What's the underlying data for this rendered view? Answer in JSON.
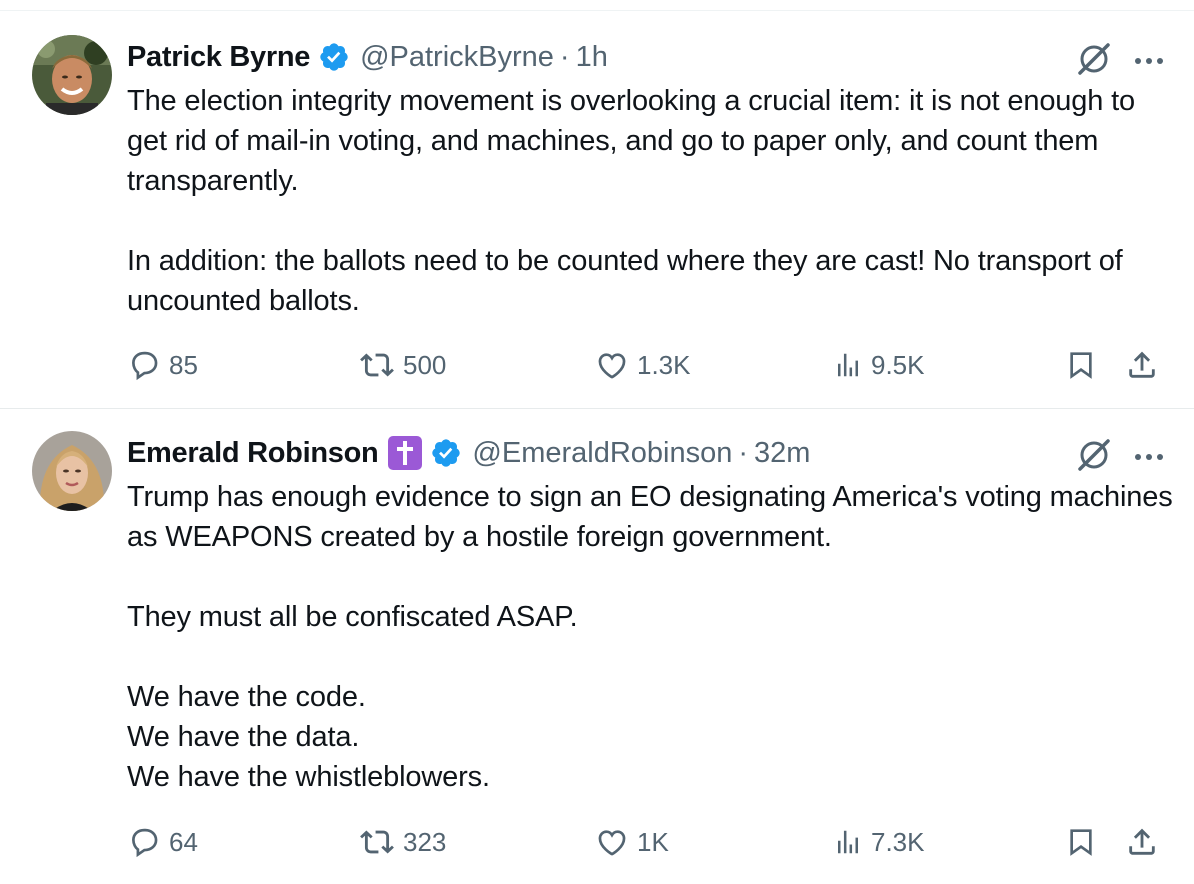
{
  "tweets": [
    {
      "author": {
        "name": "Patrick Byrne",
        "handle": "@PatrickByrne",
        "verified": true,
        "avatar_icon": "avatar-photo"
      },
      "separator": "·",
      "time": "1h",
      "paragraphs": [
        "The election integrity movement is overlooking a crucial item: it is not enough to get rid of mail-in voting, and machines, and go to paper only, and count them transparently.",
        "In addition: the ballots need to be counted where they are cast! No transport of uncounted ballots."
      ],
      "stats": {
        "replies": "85",
        "reposts": "500",
        "likes": "1.3K",
        "views": "9.5K"
      }
    },
    {
      "author": {
        "name": "Emerald Robinson",
        "handle": "@EmeraldRobinson",
        "verified": true,
        "badge": "✝",
        "avatar_icon": "avatar-photo"
      },
      "separator": "·",
      "time": "32m",
      "paragraphs": [
        "Trump has enough evidence to sign an EO designating America's voting machines as WEAPONS created by a hostile foreign government.",
        "They must all be confiscated ASAP.",
        "We have the code.\nWe have the data.\nWe have the whistleblowers."
      ],
      "stats": {
        "replies": "64",
        "reposts": "323",
        "likes": "1K",
        "views": "7.3K"
      }
    }
  ],
  "colors": {
    "text": "#0f1419",
    "muted": "#536471",
    "verified": "#1d9bf0",
    "cross_badge": "#9b59d6",
    "divider": "#e7ebec"
  }
}
